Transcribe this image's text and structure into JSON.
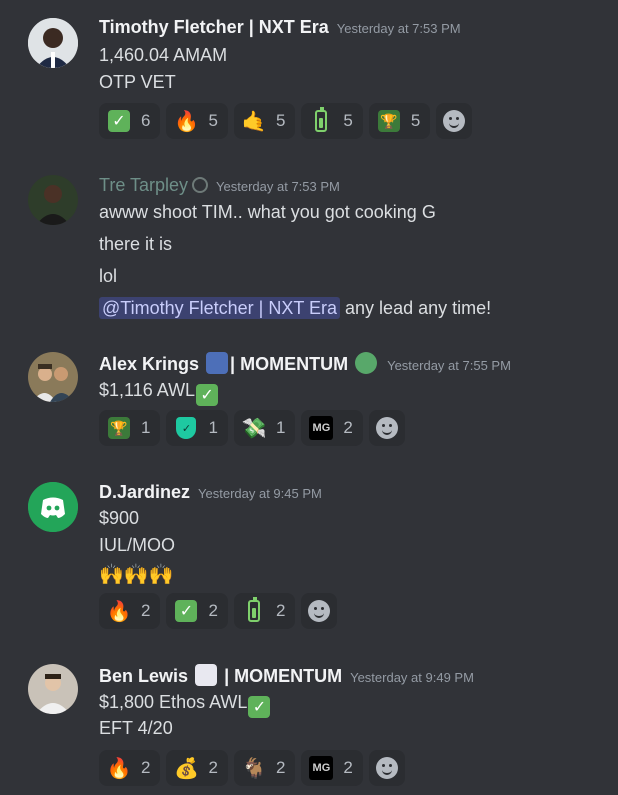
{
  "messages": [
    {
      "author": "Timothy Fletcher | NXT Era",
      "timestamp": "Yesterday at 7:53 PM",
      "lines": [
        "1,460.04 AMAM",
        "OTP VET"
      ],
      "reactions": [
        {
          "icon": "check-mark-icon",
          "count": "6"
        },
        {
          "icon": "fire-icon",
          "count": "5"
        },
        {
          "icon": "call-me-hand-icon",
          "count": "5"
        },
        {
          "icon": "battery-icon",
          "count": "5"
        },
        {
          "icon": "trophy-icon",
          "count": "5"
        }
      ]
    },
    {
      "author": "Tre Tarpley",
      "timestamp": "Yesterday at 7:53 PM",
      "lines": [
        "awww shoot TIM.. what you got cooking G",
        "there it is",
        "lol"
      ],
      "mention": "@Timothy Fletcher | NXT Era",
      "mention_suffix": "any lead any time!"
    },
    {
      "author_prefix": "Alex Krings",
      "author_suffix": "| MOMENTUM",
      "timestamp": "Yesterday at 7:55 PM",
      "lines": [
        "$1,116 AWL"
      ],
      "reactions": [
        {
          "icon": "trophy-icon",
          "count": "1"
        },
        {
          "icon": "shield-icon",
          "count": "1"
        },
        {
          "icon": "money-with-wings-icon",
          "count": "1"
        },
        {
          "icon": "momentum-logo-icon",
          "count": "2"
        }
      ]
    },
    {
      "author": "D.Jardinez",
      "timestamp": "Yesterday at 9:45 PM",
      "lines": [
        "$900",
        "IUL/MOO"
      ],
      "reactions": [
        {
          "icon": "fire-icon",
          "count": "2"
        },
        {
          "icon": "check-mark-icon",
          "count": "2"
        },
        {
          "icon": "battery-icon",
          "count": "2"
        }
      ]
    },
    {
      "author_prefix": "Ben Lewis",
      "author_suffix": "| MOMENTUM",
      "timestamp": "Yesterday at 9:49 PM",
      "lines": [
        "$1,800 Ethos AWL",
        "EFT 4/20"
      ],
      "reactions": [
        {
          "icon": "fire-icon",
          "count": "2"
        },
        {
          "icon": "money-bag-icon",
          "count": "2"
        },
        {
          "icon": "goat-icon",
          "count": "2"
        },
        {
          "icon": "momentum-logo-icon",
          "count": "2"
        }
      ]
    }
  ],
  "logo_text": "MG"
}
